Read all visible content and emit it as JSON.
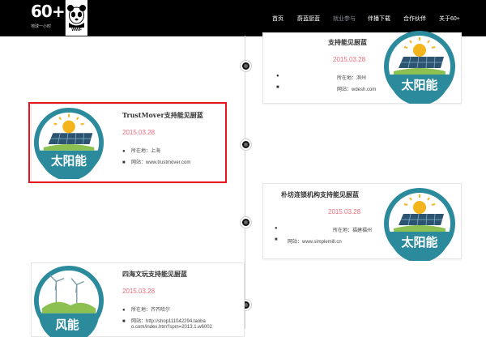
{
  "header": {
    "logo_text": "60+",
    "logo_subtitle": "地球一小时",
    "wwf_text": "WWF",
    "nav": [
      "首页",
      "蔚蓝厨蓝",
      "就业参与",
      "伴播下载",
      "合作伙伴",
      "关于60+"
    ],
    "active_nav_index": 2
  },
  "timeline": {
    "cards": [
      {
        "title": "支持能见厨蓝",
        "date": "2015.03.28",
        "location": "所在地：滨州",
        "website": "网站：wdesh.com",
        "badge_label": "太阳能"
      },
      {
        "title": "TrustMover支持能见厨蓝",
        "date": "2015.03.28",
        "location": "所在地：上海",
        "website": "网站：www.trustmover.com",
        "badge_label": "太阳能"
      },
      {
        "title": "朴坊连锁机构支持能见厨蓝",
        "date": "2015.03.28",
        "location": "所在地：福建福州",
        "website": "网站：www.simplemill.cn",
        "badge_label": "太阳能"
      },
      {
        "title": "四海文玩支持能见厨蓝",
        "date": "2015.03.28",
        "location": "所在地：齐齐哈尔",
        "website_line1": "网站：http://shop111042294.taoba",
        "website_line2": "o.com/index.htm?spm=2013.1.w6002",
        "badge_label": "风能"
      }
    ]
  },
  "colors": {
    "badge_teal": "#2b8a9c",
    "highlight_red": "#e8161c",
    "date_pink": "#ef6a7a"
  },
  "icons": [
    "user-icon",
    "comment-icon",
    "panda-logo",
    "sun-icon",
    "solar-panel-icon",
    "wind-turbine-icon"
  ]
}
